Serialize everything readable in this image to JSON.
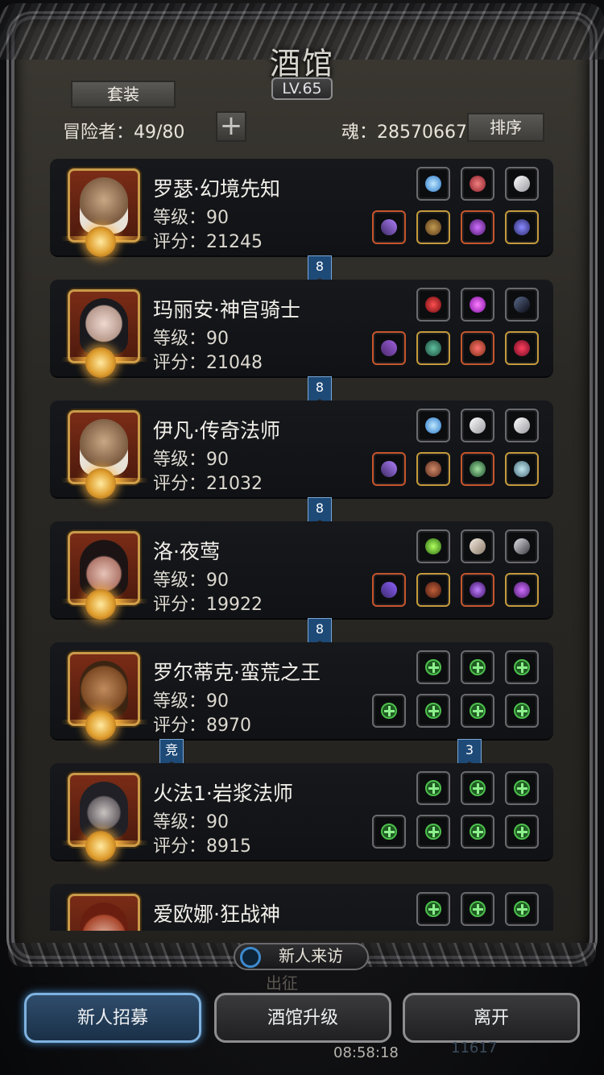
{
  "header": {
    "title": "酒馆",
    "level": "LV.65",
    "suit_button": "套装",
    "adventurers_label": "冒险者：49/80",
    "add_icon": "plus-icon",
    "soul_label": "魂：28570667",
    "sort_button": "排序"
  },
  "heroes": [
    {
      "name": "罗瑟·幻境先知",
      "level": "等级：90",
      "score": "评分：21245",
      "portrait": "old-sage-portrait",
      "ribbon": "8",
      "equip": [
        "blue-orb-icon",
        "red-gem-icon",
        "white-wing-icon",
        "staff-icon",
        "chest-armor-icon",
        "pendant-icon",
        "ring-icon"
      ]
    },
    {
      "name": "玛丽安·神官骑士",
      "level": "等级：90",
      "score": "评分：21048",
      "portrait": "priestess-portrait",
      "ribbon": "8",
      "equip": [
        "red-heart-icon",
        "purple-crystal-icon",
        "dark-wing-icon",
        "mace-icon",
        "green-armor-icon",
        "amulet-icon",
        "red-ring-icon"
      ]
    },
    {
      "name": "伊凡·传奇法师",
      "level": "等级：90",
      "score": "评分：21032",
      "portrait": "old-sage-portrait",
      "ribbon": "8",
      "equip": [
        "blue-orb-icon",
        "white-wing-icon",
        "white-wing-icon",
        "staff-icon",
        "robe-icon",
        "necklace-icon",
        "bracelet-icon"
      ]
    },
    {
      "name": "洛·夜莺",
      "level": "等级：90",
      "score": "评分：19922",
      "portrait": "hooded-girl-portrait",
      "ribbon": "8",
      "equip": [
        "green-gem-icon",
        "feather-icon",
        "blade-icon",
        "dagger-icon",
        "leather-armor-icon",
        "mask-icon",
        "pendant-icon"
      ]
    },
    {
      "name": "罗尔蒂克·蛮荒之王",
      "level": "等级：90",
      "score": "评分：8970",
      "portrait": "barbarian-portrait",
      "ribbon": "竞",
      "ribbon2": "3",
      "equip": [
        "empty-slot-icon",
        "empty-slot-icon",
        "empty-slot-icon",
        "empty-slot-icon",
        "empty-slot-icon",
        "empty-slot-icon",
        "empty-slot-icon"
      ]
    },
    {
      "name": "火法1·岩浆法师",
      "level": "等级：90",
      "score": "评分：8915",
      "portrait": "hooded-mage-portrait",
      "equip": [
        "empty-slot-icon",
        "empty-slot-icon",
        "empty-slot-icon",
        "empty-slot-icon",
        "empty-slot-icon",
        "empty-slot-icon",
        "empty-slot-icon"
      ]
    },
    {
      "name": "爱欧娜·狂战神",
      "level": "",
      "score": "",
      "portrait": "red-hair-portrait",
      "equip": [
        "empty-slot-icon",
        "empty-slot-icon",
        "empty-slot-icon"
      ]
    }
  ],
  "footer": {
    "visit_button": "新人来访",
    "visit_icon": "compass-icon",
    "recruit_button": "新人招募",
    "upgrade_button": "酒馆升级",
    "leave_button": "离开",
    "behind_text": "出征",
    "clock": "08:58:18",
    "behind_count": "11617"
  },
  "colors": {
    "accent_blue": "#7fb2df",
    "gold": "#c89a4a",
    "frame": "#5a5a5e"
  }
}
